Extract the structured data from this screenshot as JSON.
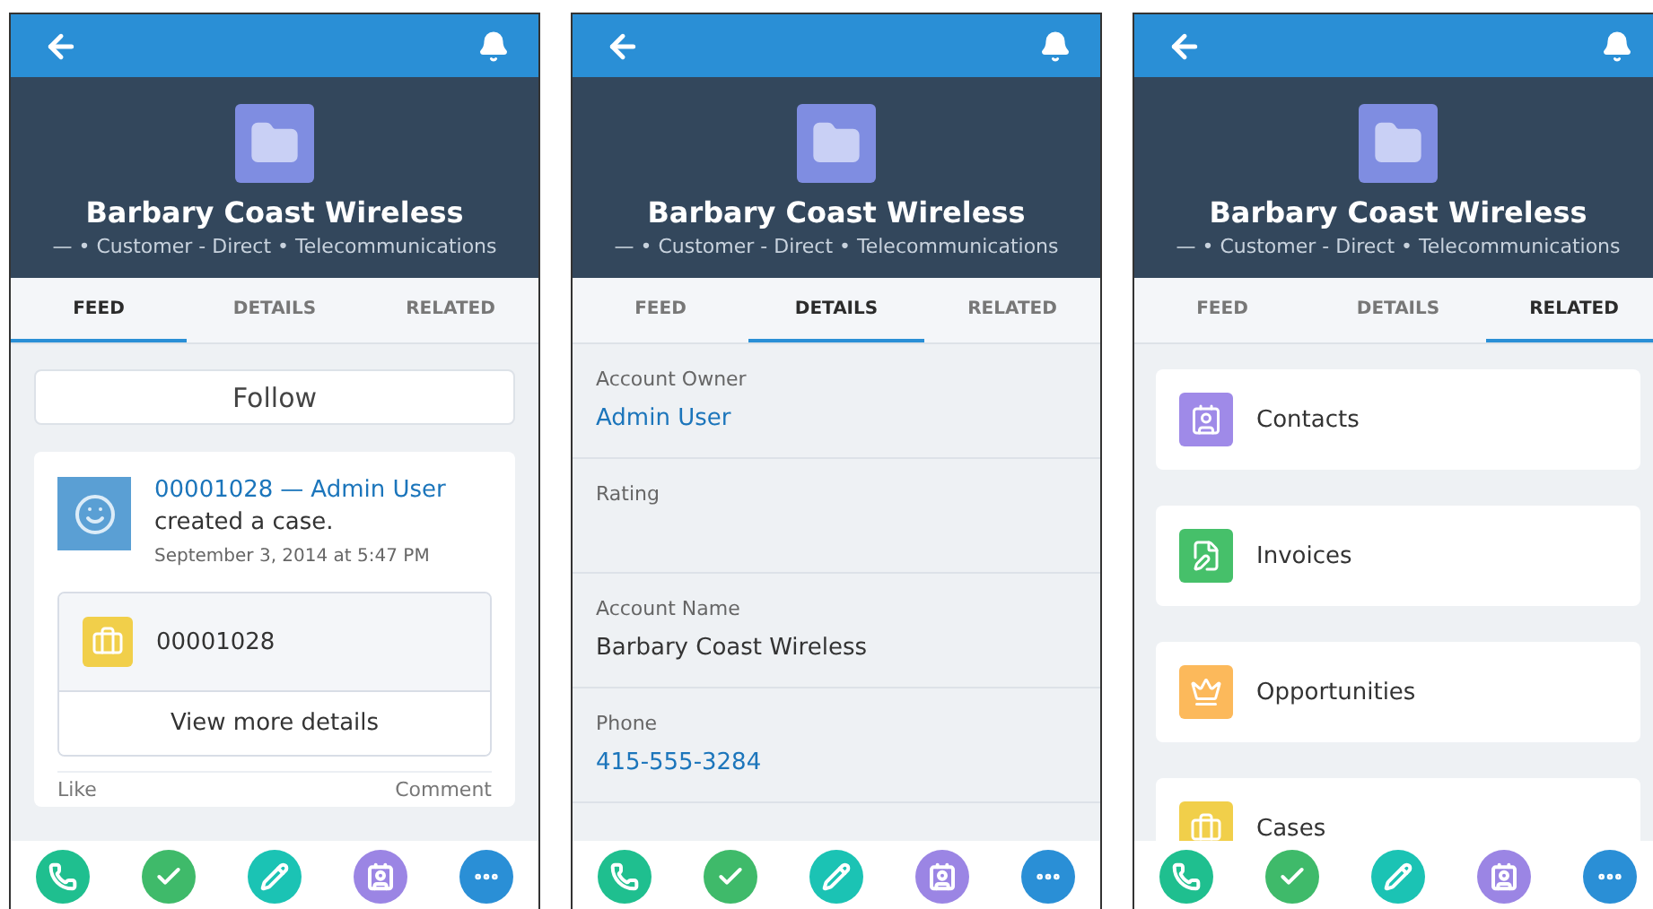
{
  "screens": [
    {
      "kind": "feed",
      "title": "Barbary Coast Wireless",
      "subtitle": "— • Customer - Direct • Telecommunications",
      "tabs": [
        {
          "label": "FEED",
          "selected": true
        },
        {
          "label": "DETAILS",
          "selected": false
        },
        {
          "label": "RELATED",
          "selected": false
        }
      ],
      "follow_button": "Follow",
      "post": {
        "record_link": "00001028",
        "separator": "—",
        "author_link": "Admin User",
        "action": "created a case.",
        "time": "September 3, 2014 at 5:47 PM",
        "record_name": "00001028",
        "more_button": "View more details",
        "like": "Like",
        "comment": "Comment"
      },
      "actions": [
        {
          "kind": "call",
          "color": "#1fbf8f"
        },
        {
          "kind": "task",
          "color": "#3fba6a"
        },
        {
          "kind": "edit",
          "color": "#1bc3b4"
        },
        {
          "kind": "contact",
          "color": "#9b85e4"
        },
        {
          "kind": "more",
          "color": "#2a8fd6"
        }
      ]
    },
    {
      "kind": "details",
      "title": "Barbary Coast Wireless",
      "subtitle": "— • Customer - Direct • Telecommunications",
      "tabs": [
        {
          "label": "FEED",
          "selected": false
        },
        {
          "label": "DETAILS",
          "selected": true
        },
        {
          "label": "RELATED",
          "selected": false
        }
      ],
      "fields": [
        {
          "label": "Account Owner",
          "value": "Admin User",
          "is_link": true
        },
        {
          "label": "Rating"
        },
        {
          "label": "Account Name",
          "value": "Barbary Coast Wireless",
          "is_link": false
        },
        {
          "label": "Phone",
          "value": "415-555-3284",
          "is_link": true
        }
      ],
      "actions": [
        {
          "kind": "call",
          "color": "#1fbf8f"
        },
        {
          "kind": "task",
          "color": "#3fba6a"
        },
        {
          "kind": "edit",
          "color": "#1bc3b4"
        },
        {
          "kind": "contact",
          "color": "#9b85e4"
        },
        {
          "kind": "more",
          "color": "#2a8fd6"
        }
      ]
    },
    {
      "kind": "related",
      "title": "Barbary Coast Wireless",
      "subtitle": "— • Customer - Direct • Telecommunications",
      "tabs": [
        {
          "label": "FEED",
          "selected": false
        },
        {
          "label": "DETAILS",
          "selected": false
        },
        {
          "label": "RELATED",
          "selected": true
        }
      ],
      "lists": [
        {
          "label": "Contacts",
          "kind": "contact",
          "color": "#9f8ae8"
        },
        {
          "label": "Invoices",
          "kind": "invoice",
          "color": "#46c06a"
        },
        {
          "label": "Opportunities",
          "kind": "opportunity",
          "color": "#fcb95b"
        },
        {
          "label": "Cases",
          "kind": "case",
          "color": "#f1cf4a"
        }
      ],
      "actions": [
        {
          "kind": "call",
          "color": "#1fbf8f"
        },
        {
          "kind": "task",
          "color": "#3fba6a"
        },
        {
          "kind": "edit",
          "color": "#1bc3b4"
        },
        {
          "kind": "contact",
          "color": "#9b85e4"
        },
        {
          "kind": "more",
          "color": "#2a8fd6"
        }
      ]
    }
  ]
}
